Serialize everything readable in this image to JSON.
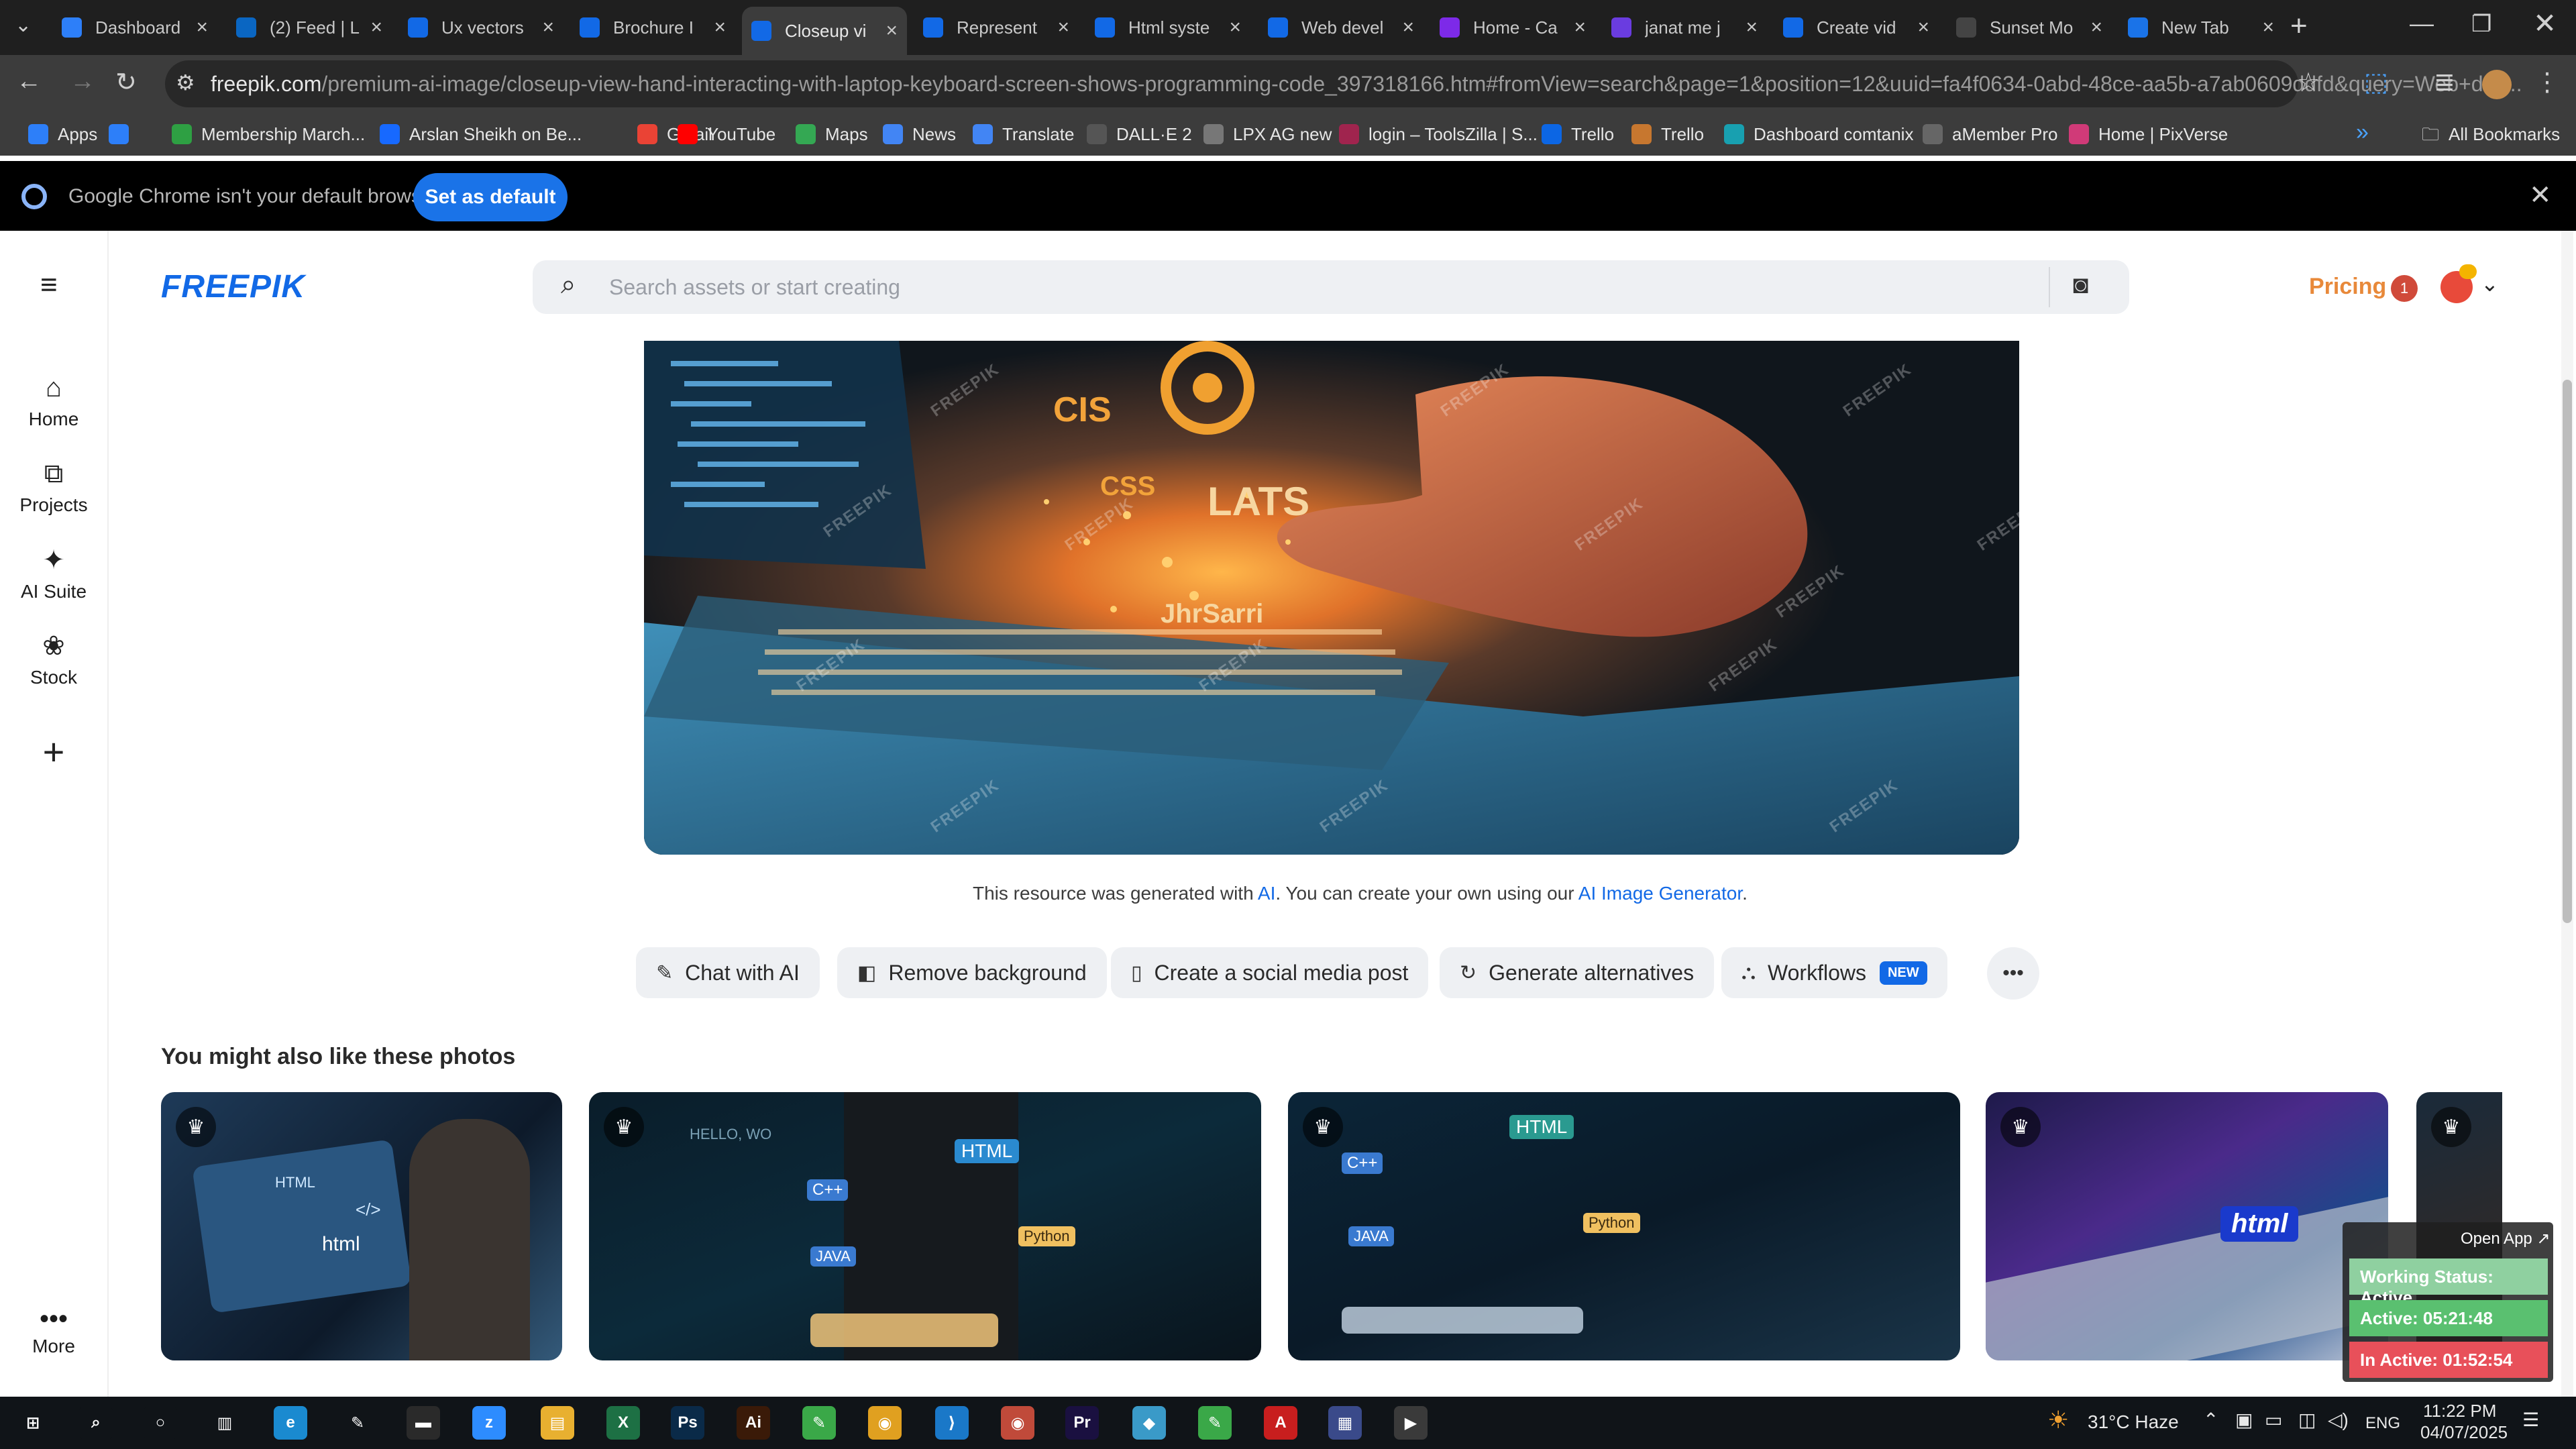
{
  "browser": {
    "tabs": [
      {
        "title": "Dashboard",
        "icon": "globe-icon",
        "color": "#2d7ff9"
      },
      {
        "title": "(2) Feed | L",
        "icon": "linkedin-icon",
        "color": "#0a66c2"
      },
      {
        "title": "Ux vectors",
        "icon": "freepik-icon",
        "color": "#1269e6"
      },
      {
        "title": "Brochure I",
        "icon": "freepik-icon",
        "color": "#1269e6"
      },
      {
        "title": "Closeup vi",
        "icon": "freepik-icon",
        "color": "#1269e6"
      },
      {
        "title": "Represent",
        "icon": "freepik-icon",
        "color": "#1269e6"
      },
      {
        "title": "Html syste",
        "icon": "freepik-icon",
        "color": "#1269e6"
      },
      {
        "title": "Web devel",
        "icon": "freepik-icon",
        "color": "#1269e6"
      },
      {
        "title": "Home - Ca",
        "icon": "canva-icon",
        "color": "#7d2ae8"
      },
      {
        "title": "janat me j",
        "icon": "video-icon",
        "color": "#6a3ce0"
      },
      {
        "title": "Create vid",
        "icon": "freepik-icon",
        "color": "#1269e6"
      },
      {
        "title": "Sunset Mo",
        "icon": "openai-icon",
        "color": "#444444"
      },
      {
        "title": "New Tab",
        "icon": "chrome-icon",
        "color": "#1a73e8"
      }
    ],
    "url": {
      "host": "freepik.com",
      "path": "/premium-ai-image/closeup-view-hand-interacting-with-laptop-keyboard-screen-shows-programming-code_397318166.htm#fromView=search&page=1&position=12&uuid=fa4f0634-0abd-48ce-aa5b-a7ab0609ddfd&query=Web+dev..."
    },
    "bookmarks": [
      {
        "label": "Apps",
        "icon": "apps-grid-icon",
        "color": "#2d7ff9"
      },
      {
        "label": "",
        "icon": "tab-groups-icon",
        "color": "#2d7ff9"
      },
      {
        "label": "Membership March...",
        "icon": "bookmark-icon",
        "color": "#2ea043"
      },
      {
        "label": "Arslan Sheikh on Be...",
        "icon": "behance-icon",
        "color": "#1769ff"
      },
      {
        "label": "Gmail",
        "icon": "gmail-icon",
        "color": "#ea4335"
      },
      {
        "label": "YouTube",
        "icon": "youtube-icon",
        "color": "#ff0000"
      },
      {
        "label": "Maps",
        "icon": "maps-icon",
        "color": "#34a853"
      },
      {
        "label": "News",
        "icon": "news-icon",
        "color": "#4285f4"
      },
      {
        "label": "Translate",
        "icon": "translate-icon",
        "color": "#4285f4"
      },
      {
        "label": "DALL·E 2",
        "icon": "openai-icon",
        "color": "#555555"
      },
      {
        "label": "LPX AG new",
        "icon": "globe-icon",
        "color": "#777777"
      },
      {
        "label": "login – ToolsZilla | S...",
        "icon": "toolszilla-icon",
        "color": "#a0244e"
      },
      {
        "label": "Trello",
        "icon": "trello-icon",
        "color": "#0c66e4"
      },
      {
        "label": "Trello",
        "icon": "trello-icon",
        "color": "#c7772f"
      },
      {
        "label": "Dashboard comtanix",
        "icon": "globe-icon",
        "color": "#18a0b0"
      },
      {
        "label": "aMember Pro",
        "icon": "globe-icon",
        "color": "#666666"
      },
      {
        "label": "Home | PixVerse",
        "icon": "pixverse-icon",
        "color": "#d03a78"
      }
    ],
    "all_bookmarks": "All Bookmarks",
    "infobar": {
      "message": "Google Chrome isn't your default browser",
      "button": "Set as default"
    }
  },
  "site": {
    "logo": "FREEPIK",
    "search_placeholder": "Search assets or start creating",
    "pricing": "Pricing",
    "notification_count": "1",
    "nav": [
      {
        "label": "Home",
        "icon": "home-icon"
      },
      {
        "label": "Projects",
        "icon": "projects-icon"
      },
      {
        "label": "AI Suite",
        "icon": "sparkles-icon"
      },
      {
        "label": "Stock",
        "icon": "stock-icon"
      },
      {
        "label": "",
        "icon": "plus-icon"
      }
    ],
    "nav_more": "More",
    "hero_overlay_text": [
      "CIS",
      "CSS",
      "LATS",
      "JhrSarri"
    ],
    "watermark": "FREEPIK",
    "resource_note": {
      "prefix": "This resource was generated with",
      "ai_link": "AI",
      "middle": ". You can create your own using our",
      "generator_link": "AI Image Generator",
      "suffix": "."
    },
    "actions": [
      {
        "label": "Chat with AI",
        "icon": "chat-edit-icon"
      },
      {
        "label": "Remove background",
        "icon": "remove-bg-icon"
      },
      {
        "label": "Create a social media post",
        "icon": "phone-icon"
      },
      {
        "label": "Generate alternatives",
        "icon": "refresh-icon"
      },
      {
        "label": "Workflows",
        "icon": "workflow-icon",
        "badge": "NEW"
      }
    ],
    "related_title": "You might also like these photos",
    "related_labels": [
      [
        "HTML",
        "</>",
        "html"
      ],
      [
        "HTML",
        "C++",
        "JAVA",
        "Python",
        "HELLO, WO"
      ],
      [
        "HTML",
        "C++",
        "JAVA",
        "Python"
      ],
      [
        "html"
      ]
    ]
  },
  "tracker": {
    "open_app": "Open App ↗",
    "status": "Working Status: Active",
    "active": "Active: 05:21:48",
    "inactive": "In Active: 01:52:54"
  },
  "taskbar": {
    "apps": [
      {
        "icon": "windows-start-icon"
      },
      {
        "icon": "search-icon"
      },
      {
        "icon": "cortana-icon"
      },
      {
        "icon": "task-view-icon"
      },
      {
        "icon": "edge-icon"
      },
      {
        "icon": "pen-icon"
      },
      {
        "icon": "terminal-icon"
      },
      {
        "icon": "zoom-icon"
      },
      {
        "icon": "file-explorer-icon"
      },
      {
        "icon": "excel-icon"
      },
      {
        "icon": "photoshop-icon"
      },
      {
        "icon": "illustrator-icon"
      },
      {
        "icon": "green-app-icon"
      },
      {
        "icon": "chrome-icon"
      },
      {
        "icon": "vscode-icon"
      },
      {
        "icon": "chrome-profile-icon"
      },
      {
        "icon": "premiere-icon"
      },
      {
        "icon": "blue-app-icon"
      },
      {
        "icon": "green-app-icon"
      },
      {
        "icon": "acrobat-icon"
      },
      {
        "icon": "calculator-icon"
      },
      {
        "icon": "media-player-icon"
      }
    ],
    "weather": "31°C Haze",
    "lang": "ENG",
    "time": "11:22 PM",
    "date": "04/07/2025"
  }
}
